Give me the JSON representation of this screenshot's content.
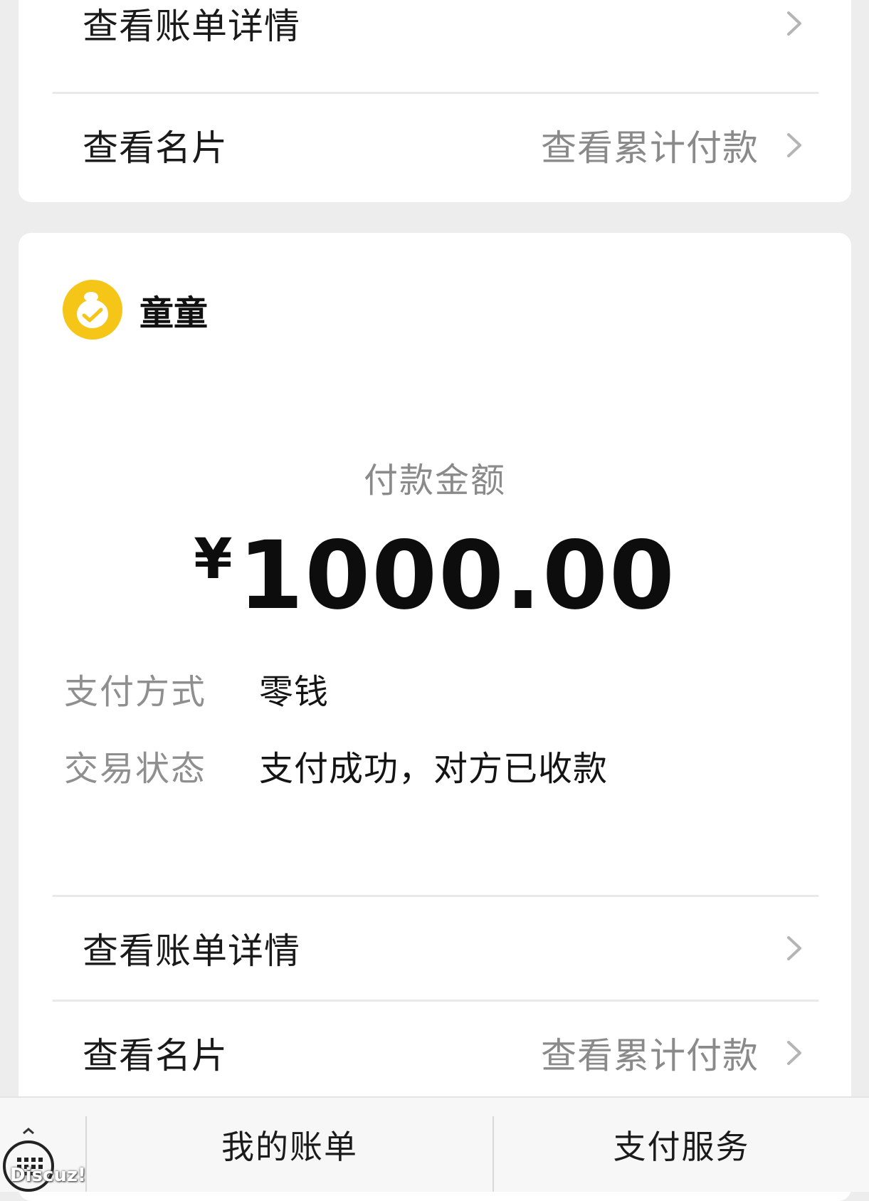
{
  "top_card": {
    "bill_details_label": "查看账单详情",
    "business_card_label": "查看名片",
    "cumulative_payment_label": "查看累计付款"
  },
  "payment": {
    "payee_name": "童童",
    "amount_label": "付款金额",
    "currency_symbol": "¥",
    "amount": "1000.00",
    "method_label": "支付方式",
    "method_value": "零钱",
    "status_label": "交易状态",
    "status_value": "支付成功，对方已收款",
    "bill_details_label": "查看账单详情",
    "business_card_label": "查看名片",
    "cumulative_payment_label": "查看累计付款"
  },
  "tabbar": {
    "my_bills": "我的账单",
    "payment_services": "支付服务"
  },
  "watermark": "Discuz!",
  "colors": {
    "background": "#ededed",
    "card": "#ffffff",
    "avatar": "#f5c518"
  },
  "icons": [
    "chevron-right-icon",
    "payee-avatar-icon",
    "keyboard-icon"
  ]
}
